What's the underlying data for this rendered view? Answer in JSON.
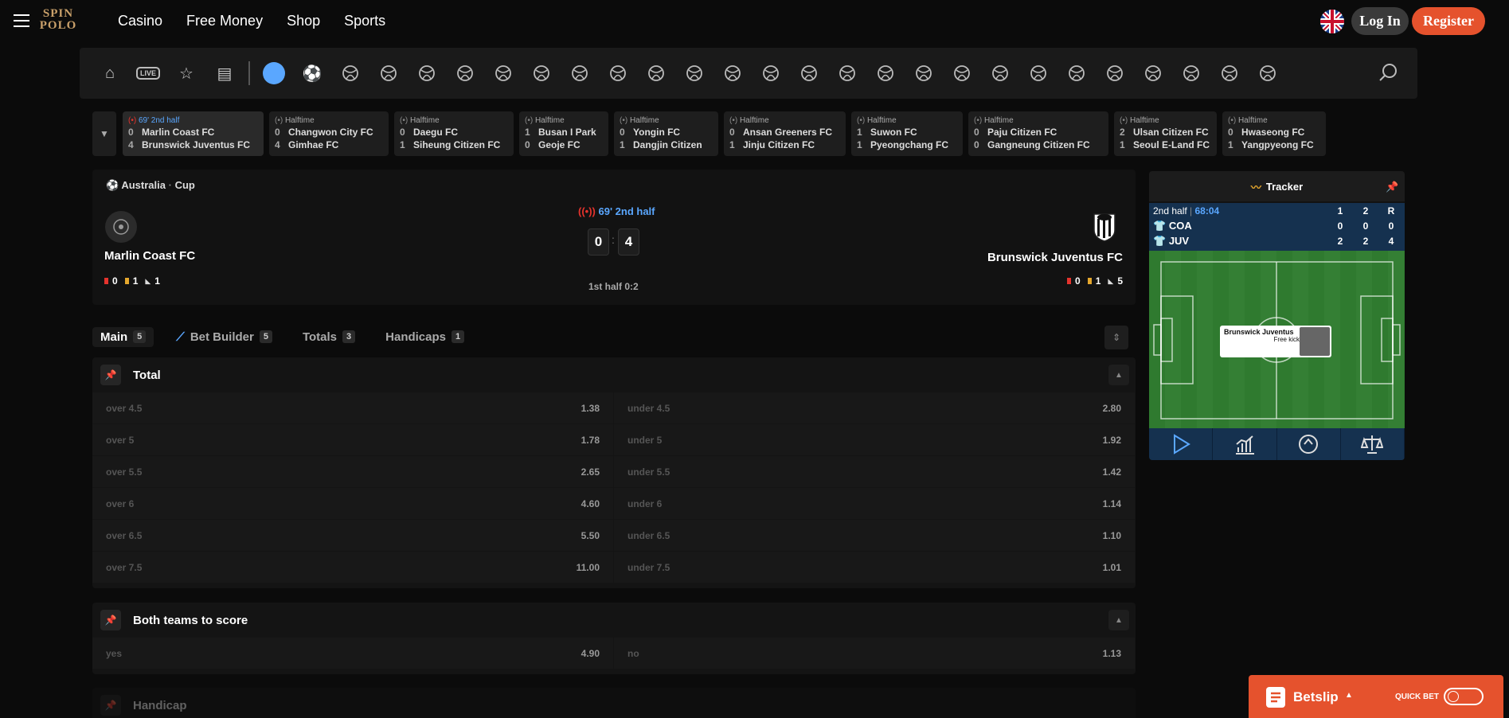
{
  "brand": {
    "line1": "SPIN",
    "line2": "POLO"
  },
  "topnav": [
    "Casino",
    "Free Money",
    "Shop",
    "Sports"
  ],
  "auth": {
    "login": "Log In",
    "register": "Register"
  },
  "sportbar": {
    "icons": [
      "home-icon",
      "live-icon",
      "favorites-icon",
      "betslip-history-icon",
      "all-sports-icon",
      "soccer-icon",
      "esoccer-icon",
      "basketball-icon",
      "tennis-icon",
      "hockey-icon",
      "counter-strike-icon",
      "valorant-icon",
      "dota-icon",
      "chess-icon",
      "racing-icon",
      "volleyball-esport-icon",
      "volleyball-icon",
      "handball-icon",
      "volta-icon",
      "penalty-icon",
      "table-tennis-icon",
      "badminton-icon",
      "boxing-icon",
      "baseball-icon",
      "snooker-icon",
      "cricket-icon",
      "ebasketball-icon",
      "blitz-icon",
      "darts-icon",
      "baseball-bat-icon",
      "rugby-icon"
    ],
    "live_label": "LIVE"
  },
  "events": [
    {
      "status": "69' 2nd half",
      "home": "Marlin Coast FC",
      "away": "Brunswick Juventus FC",
      "home_score": "0",
      "away_score": "4",
      "active": true
    },
    {
      "status": "Halftime",
      "home": "Changwon City FC",
      "away": "Gimhae FC",
      "home_score": "0",
      "away_score": "4"
    },
    {
      "status": "Halftime",
      "home": "Daegu FC",
      "away": "Siheung Citizen FC",
      "home_score": "0",
      "away_score": "1"
    },
    {
      "status": "Halftime",
      "home": "Busan I Park",
      "away": "Geoje FC",
      "home_score": "1",
      "away_score": "0"
    },
    {
      "status": "Halftime",
      "home": "Yongin FC",
      "away": "Dangjin Citizen",
      "home_score": "0",
      "away_score": "1"
    },
    {
      "status": "Halftime",
      "home": "Ansan Greeners FC",
      "away": "Jinju Citizen FC",
      "home_score": "0",
      "away_score": "1"
    },
    {
      "status": "Halftime",
      "home": "Suwon FC",
      "away": "Pyeongchang FC",
      "home_score": "1",
      "away_score": "1"
    },
    {
      "status": "Halftime",
      "home": "Paju Citizen FC",
      "away": "Gangneung Citizen FC",
      "home_score": "0",
      "away_score": "0"
    },
    {
      "status": "Halftime",
      "home": "Ulsan Citizen FC",
      "away": "Seoul E-Land FC",
      "home_score": "2",
      "away_score": "1"
    },
    {
      "status": "Halftime",
      "home": "Hwaseong FC",
      "away": "Yangpyeong FC",
      "home_score": "0",
      "away_score": "1"
    }
  ],
  "match": {
    "country": "Australia",
    "competition": "Cup",
    "separator": "·",
    "live_time": "69' 2nd half",
    "home": {
      "name": "Marlin Coast FC",
      "score": "0",
      "red": "0",
      "yellow": "1",
      "corners": "1"
    },
    "away": {
      "name": "Brunswick Juventus FC",
      "score": "4",
      "red": "0",
      "yellow": "1",
      "corners": "5"
    },
    "colon": ":",
    "first_half": "1st half 0:2"
  },
  "tabs": [
    {
      "label": "Main",
      "count": "5"
    },
    {
      "label": "Bet Builder",
      "count": "5"
    },
    {
      "label": "Totals",
      "count": "3"
    },
    {
      "label": "Handicaps",
      "count": "1"
    }
  ],
  "markets": {
    "total": {
      "title": "Total",
      "rows": [
        {
          "l": "over 4.5",
          "lo": "1.38",
          "r": "under 4.5",
          "ro": "2.80"
        },
        {
          "l": "over 5",
          "lo": "1.78",
          "r": "under 5",
          "ro": "1.92"
        },
        {
          "l": "over 5.5",
          "lo": "2.65",
          "r": "under 5.5",
          "ro": "1.42"
        },
        {
          "l": "over 6",
          "lo": "4.60",
          "r": "under 6",
          "ro": "1.14"
        },
        {
          "l": "over 6.5",
          "lo": "5.50",
          "r": "under 6.5",
          "ro": "1.10"
        },
        {
          "l": "over 7.5",
          "lo": "11.00",
          "r": "under 7.5",
          "ro": "1.01"
        }
      ]
    },
    "btts": {
      "title": "Both teams to score",
      "rows": [
        {
          "l": "yes",
          "lo": "4.90",
          "r": "no",
          "ro": "1.13"
        }
      ]
    },
    "handicap": {
      "title": "Handicap"
    }
  },
  "tracker": {
    "title": "Tracker",
    "period": "2nd half",
    "clock": "68:04",
    "headers": [
      "1",
      "2",
      "R"
    ],
    "teams": [
      {
        "abbr": "COA",
        "v": [
          "0",
          "0",
          "0"
        ]
      },
      {
        "abbr": "JUV",
        "v": [
          "2",
          "2",
          "4"
        ]
      }
    ],
    "popup_team": "Brunswick Juventus",
    "popup_event": "Free kick"
  },
  "betslip": {
    "title": "Betslip",
    "quick_bet": "QUICK BET"
  },
  "colors": {
    "accent": "#e5522d",
    "live": "#5aa7ff",
    "tracker_bg": "#15314f",
    "pitch": "#2f7a2f"
  }
}
